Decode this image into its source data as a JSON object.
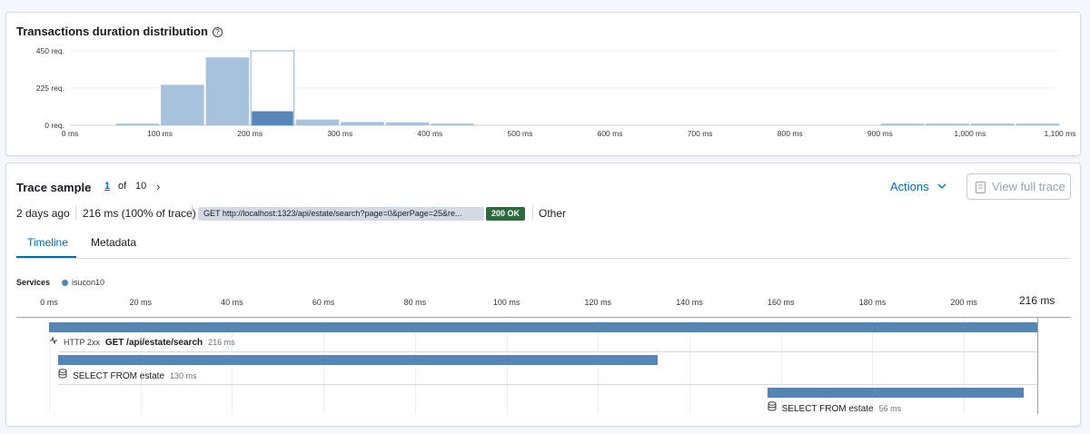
{
  "distribution": {
    "title": "Transactions duration distribution",
    "help_icon": "?",
    "chart_data": {
      "type": "bar",
      "title": "Transactions duration distribution",
      "xlabel": "",
      "ylabel": "",
      "x_ticks": [
        "0 ms",
        "100 ms",
        "200 ms",
        "300 ms",
        "400 ms",
        "500 ms",
        "600 ms",
        "700 ms",
        "800 ms",
        "900 ms",
        "1,000 ms",
        "1,100 ms"
      ],
      "y_ticks": [
        "450 req.",
        "225 req.",
        "0 req."
      ],
      "ylim": [
        0,
        450
      ],
      "xlim": [
        0,
        1100
      ],
      "bin_width_ms": 50,
      "bins": [
        {
          "start": 50,
          "value": 10
        },
        {
          "start": 100,
          "value": 245
        },
        {
          "start": 150,
          "value": 410
        },
        {
          "start": 200,
          "value": 450,
          "selected": true
        },
        {
          "start": 250,
          "value": 35
        },
        {
          "start": 300,
          "value": 20
        },
        {
          "start": 350,
          "value": 18
        },
        {
          "start": 400,
          "value": 10
        },
        {
          "start": 900,
          "value": 10
        },
        {
          "start": 950,
          "value": 10
        },
        {
          "start": 1000,
          "value": 10
        },
        {
          "start": 1050,
          "value": 10
        }
      ],
      "sample_bin": {
        "start": 200,
        "value": 85
      },
      "colors": {
        "bar": "#a9c2db",
        "sample": "#5586b6",
        "selected_outline": "#8fb0cf"
      }
    }
  },
  "trace": {
    "title": "Trace sample",
    "page_current": "1",
    "page_of": "of",
    "page_total": "10",
    "actions_label": "Actions",
    "view_full_trace_label": "View full trace",
    "age": "2 days ago",
    "duration": "216 ms (100% of trace)",
    "url": "GET http://localhost:1323/api/estate/search?page=0&perPage=25&re...",
    "status": "200 OK",
    "type": "Other",
    "tabs": [
      "Timeline",
      "Metadata"
    ],
    "active_tab": 0
  },
  "timeline": {
    "services_label": "Services",
    "service_name": "isucon10",
    "service_color": "#5586b6",
    "ticks": [
      "0 ms",
      "20 ms",
      "40 ms",
      "60 ms",
      "80 ms",
      "100 ms",
      "120 ms",
      "140 ms",
      "160 ms",
      "180 ms",
      "200 ms"
    ],
    "total_label": "216 ms",
    "total_ms": 216,
    "tick_step_ms": 20,
    "spans": [
      {
        "start": 0,
        "duration": 216,
        "kind": "transaction",
        "icon": "http-icon",
        "type_label": "HTTP 2xx",
        "name": "GET /api/estate/search",
        "duration_label": "216 ms"
      },
      {
        "start": 2,
        "duration": 131,
        "kind": "span",
        "icon": "database-icon",
        "type_label": "",
        "name": "SELECT FROM estate",
        "duration_label": "130 ms"
      },
      {
        "start": 157,
        "duration": 56,
        "kind": "span",
        "icon": "database-icon",
        "type_label": "",
        "name": "SELECT FROM estate",
        "duration_label": "56 ms"
      }
    ]
  }
}
